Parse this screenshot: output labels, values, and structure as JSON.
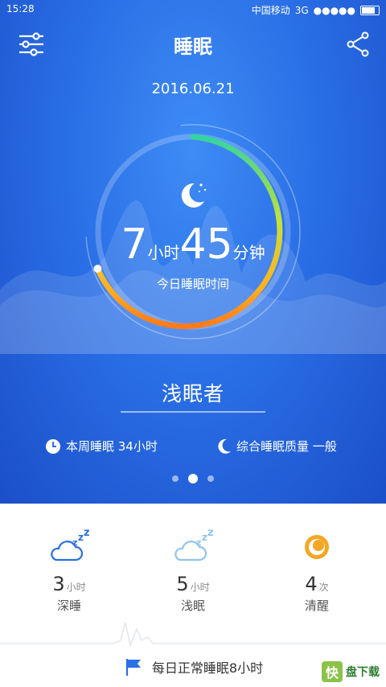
{
  "status_bar": {
    "time": "15:28",
    "carrier": "中国移动",
    "network": "3G",
    "signal": "●●●●●"
  },
  "header": {
    "title": "睡眠",
    "settings_icon": "sliders-icon",
    "share_icon": "share-icon"
  },
  "date": "2016.06.21",
  "sleep": {
    "hours": "7",
    "hours_unit": "小时",
    "minutes": "45",
    "minutes_unit": "分钟",
    "label": "今日睡眠时间"
  },
  "sleeper_type": "浅眠者",
  "stats": {
    "weekly": "本周睡眠 34小时",
    "quality": "综合睡眠质量 一般"
  },
  "pager": {
    "count": 3,
    "active": 1
  },
  "cards": [
    {
      "value": "3",
      "unit": "小时",
      "label": "深睡",
      "icon": "deep-sleep-cloud-icon"
    },
    {
      "value": "5",
      "unit": "小时",
      "label": "浅眠",
      "icon": "light-sleep-cloud-icon"
    },
    {
      "value": "4",
      "unit": "次",
      "label": "清醒",
      "icon": "awake-icon"
    }
  ],
  "goal": "每日正常睡眠8小时",
  "brand": {
    "logo": "快",
    "name": "盘下载"
  },
  "colors": {
    "background_blue": "#2a6fe6",
    "ring_green": "#3ddc84",
    "ring_orange": "#ff8c1a",
    "accent_yellow": "#f5a623"
  }
}
